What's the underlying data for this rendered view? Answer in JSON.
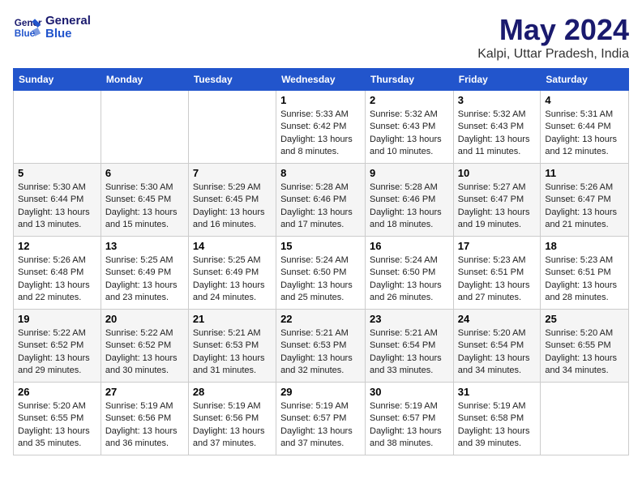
{
  "header": {
    "logo_line1": "General",
    "logo_line2": "Blue",
    "month_title": "May 2024",
    "subtitle": "Kalpi, Uttar Pradesh, India"
  },
  "weekdays": [
    "Sunday",
    "Monday",
    "Tuesday",
    "Wednesday",
    "Thursday",
    "Friday",
    "Saturday"
  ],
  "weeks": [
    [
      {
        "day": "",
        "info": ""
      },
      {
        "day": "",
        "info": ""
      },
      {
        "day": "",
        "info": ""
      },
      {
        "day": "1",
        "info": "Sunrise: 5:33 AM\nSunset: 6:42 PM\nDaylight: 13 hours\nand 8 minutes."
      },
      {
        "day": "2",
        "info": "Sunrise: 5:32 AM\nSunset: 6:43 PM\nDaylight: 13 hours\nand 10 minutes."
      },
      {
        "day": "3",
        "info": "Sunrise: 5:32 AM\nSunset: 6:43 PM\nDaylight: 13 hours\nand 11 minutes."
      },
      {
        "day": "4",
        "info": "Sunrise: 5:31 AM\nSunset: 6:44 PM\nDaylight: 13 hours\nand 12 minutes."
      }
    ],
    [
      {
        "day": "5",
        "info": "Sunrise: 5:30 AM\nSunset: 6:44 PM\nDaylight: 13 hours\nand 13 minutes."
      },
      {
        "day": "6",
        "info": "Sunrise: 5:30 AM\nSunset: 6:45 PM\nDaylight: 13 hours\nand 15 minutes."
      },
      {
        "day": "7",
        "info": "Sunrise: 5:29 AM\nSunset: 6:45 PM\nDaylight: 13 hours\nand 16 minutes."
      },
      {
        "day": "8",
        "info": "Sunrise: 5:28 AM\nSunset: 6:46 PM\nDaylight: 13 hours\nand 17 minutes."
      },
      {
        "day": "9",
        "info": "Sunrise: 5:28 AM\nSunset: 6:46 PM\nDaylight: 13 hours\nand 18 minutes."
      },
      {
        "day": "10",
        "info": "Sunrise: 5:27 AM\nSunset: 6:47 PM\nDaylight: 13 hours\nand 19 minutes."
      },
      {
        "day": "11",
        "info": "Sunrise: 5:26 AM\nSunset: 6:47 PM\nDaylight: 13 hours\nand 21 minutes."
      }
    ],
    [
      {
        "day": "12",
        "info": "Sunrise: 5:26 AM\nSunset: 6:48 PM\nDaylight: 13 hours\nand 22 minutes."
      },
      {
        "day": "13",
        "info": "Sunrise: 5:25 AM\nSunset: 6:49 PM\nDaylight: 13 hours\nand 23 minutes."
      },
      {
        "day": "14",
        "info": "Sunrise: 5:25 AM\nSunset: 6:49 PM\nDaylight: 13 hours\nand 24 minutes."
      },
      {
        "day": "15",
        "info": "Sunrise: 5:24 AM\nSunset: 6:50 PM\nDaylight: 13 hours\nand 25 minutes."
      },
      {
        "day": "16",
        "info": "Sunrise: 5:24 AM\nSunset: 6:50 PM\nDaylight: 13 hours\nand 26 minutes."
      },
      {
        "day": "17",
        "info": "Sunrise: 5:23 AM\nSunset: 6:51 PM\nDaylight: 13 hours\nand 27 minutes."
      },
      {
        "day": "18",
        "info": "Sunrise: 5:23 AM\nSunset: 6:51 PM\nDaylight: 13 hours\nand 28 minutes."
      }
    ],
    [
      {
        "day": "19",
        "info": "Sunrise: 5:22 AM\nSunset: 6:52 PM\nDaylight: 13 hours\nand 29 minutes."
      },
      {
        "day": "20",
        "info": "Sunrise: 5:22 AM\nSunset: 6:52 PM\nDaylight: 13 hours\nand 30 minutes."
      },
      {
        "day": "21",
        "info": "Sunrise: 5:21 AM\nSunset: 6:53 PM\nDaylight: 13 hours\nand 31 minutes."
      },
      {
        "day": "22",
        "info": "Sunrise: 5:21 AM\nSunset: 6:53 PM\nDaylight: 13 hours\nand 32 minutes."
      },
      {
        "day": "23",
        "info": "Sunrise: 5:21 AM\nSunset: 6:54 PM\nDaylight: 13 hours\nand 33 minutes."
      },
      {
        "day": "24",
        "info": "Sunrise: 5:20 AM\nSunset: 6:54 PM\nDaylight: 13 hours\nand 34 minutes."
      },
      {
        "day": "25",
        "info": "Sunrise: 5:20 AM\nSunset: 6:55 PM\nDaylight: 13 hours\nand 34 minutes."
      }
    ],
    [
      {
        "day": "26",
        "info": "Sunrise: 5:20 AM\nSunset: 6:55 PM\nDaylight: 13 hours\nand 35 minutes."
      },
      {
        "day": "27",
        "info": "Sunrise: 5:19 AM\nSunset: 6:56 PM\nDaylight: 13 hours\nand 36 minutes."
      },
      {
        "day": "28",
        "info": "Sunrise: 5:19 AM\nSunset: 6:56 PM\nDaylight: 13 hours\nand 37 minutes."
      },
      {
        "day": "29",
        "info": "Sunrise: 5:19 AM\nSunset: 6:57 PM\nDaylight: 13 hours\nand 37 minutes."
      },
      {
        "day": "30",
        "info": "Sunrise: 5:19 AM\nSunset: 6:57 PM\nDaylight: 13 hours\nand 38 minutes."
      },
      {
        "day": "31",
        "info": "Sunrise: 5:19 AM\nSunset: 6:58 PM\nDaylight: 13 hours\nand 39 minutes."
      },
      {
        "day": "",
        "info": ""
      }
    ]
  ]
}
